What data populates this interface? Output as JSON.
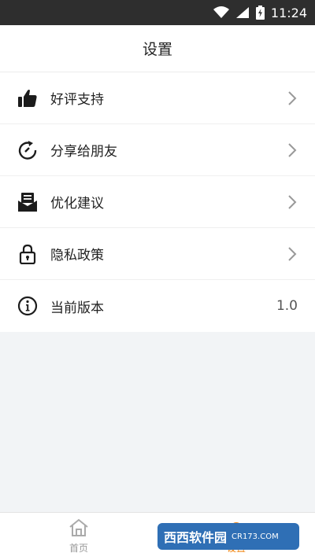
{
  "status_bar": {
    "time": "11:24"
  },
  "header": {
    "title": "设置"
  },
  "settings": [
    {
      "label": "好评支持",
      "icon": "thumbs-up-icon",
      "chevron": true
    },
    {
      "label": "分享给朋友",
      "icon": "share-refresh-icon",
      "chevron": true
    },
    {
      "label": "优化建议",
      "icon": "feedback-icon",
      "chevron": true
    },
    {
      "label": "隐私政策",
      "icon": "lock-icon",
      "chevron": true
    },
    {
      "label": "当前版本",
      "icon": "info-icon",
      "value": "1.0"
    }
  ],
  "tabbar": {
    "home_label": "首页",
    "settings_label": "设置",
    "active_color": "#f08a1c",
    "inactive_color": "#999999"
  },
  "watermark": {
    "text": "西西软件园",
    "sub": "CR173.COM"
  },
  "colors": {
    "status_bar": "#2e2e2e",
    "background": "#f2f4f6"
  }
}
